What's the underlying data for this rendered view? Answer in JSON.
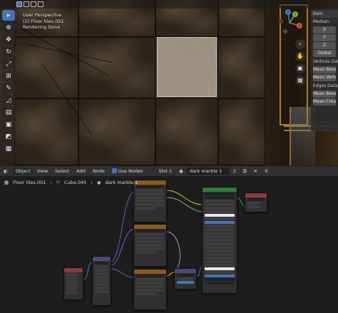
{
  "viewport": {
    "overlay_lines": [
      "User Perspective",
      "(2) Floor tiles.001",
      "Rendering Done"
    ],
    "npanel": {
      "tab_label": "Item",
      "median_label": "Median:",
      "median_buttons": [
        "X",
        "Y",
        "Z",
        "Global"
      ],
      "vertices_label": "Vertices Data:",
      "vertices_buttons": [
        "Mean Bevel",
        "Mean Verte"
      ],
      "edges_label": "Edges Data:",
      "edges_buttons": [
        "Mean Bevel",
        "Mean Crea"
      ]
    },
    "gizmo_axes": [
      "X",
      "Y",
      "Z"
    ]
  },
  "node_header": {
    "editor_icon": "node-editor-icon",
    "object_dropdown": "Object",
    "menus": [
      "View",
      "Select",
      "Add",
      "Node"
    ],
    "use_nodes_label": "Use Nodes",
    "slot_label": "Slot 1",
    "material_name": "dark marble 1",
    "user_count": "2"
  },
  "breadcrumb": [
    "Floor tiles.001",
    "Cube.045",
    "dark marble 1"
  ],
  "colors": {
    "accent": "#4772b3",
    "node_texcoord": "#8b3a3a",
    "node_mapping": "#4a4a7a",
    "node_image": "#8a5a1f",
    "node_bsdf": "#2f7a3a",
    "node_output": "#8b3a3a",
    "link_yellow": "#c7c729",
    "link_purple": "#6363c7",
    "link_gray": "#a1a1a1"
  }
}
